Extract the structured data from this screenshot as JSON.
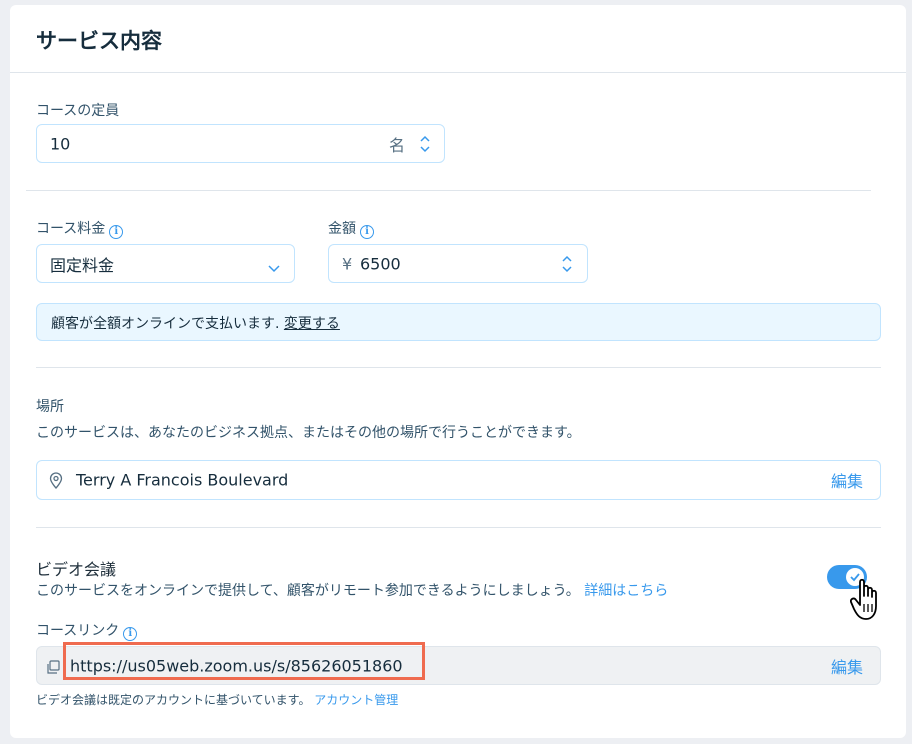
{
  "header": {
    "title": "サービス内容"
  },
  "capacity": {
    "label": "コースの定員",
    "value": "10",
    "unit": "名"
  },
  "pricing": {
    "fee_label": "コース料金",
    "fee_value": "固定料金",
    "amount_label": "金額",
    "currency_symbol": "¥",
    "amount_value": "6500",
    "notice_text": "顧客が全額オンラインで支払います.",
    "notice_link": "変更する"
  },
  "location": {
    "title": "場所",
    "description": "このサービスは、あなたのビジネス拠点、またはその他の場所で行うことができます。",
    "address": "Terry A Francois Boulevard",
    "edit_label": "編集"
  },
  "video": {
    "title": "ビデオ会議",
    "description": "このサービスをオンラインで提供して、顧客がリモート参加できるようにしましょう。",
    "details_link": "詳細はこちら",
    "toggle_on": true,
    "link_label": "コースリンク",
    "link_url": "https://us05web.zoom.us/s/85626051860",
    "link_edit_label": "編集",
    "footnote_text": "ビデオ会議は既定のアカウントに基づいています。",
    "footnote_link": "アカウント管理"
  },
  "colors": {
    "accent": "#3899ec",
    "highlight": "#ef6b4f",
    "notice_bg": "#eaf7ff"
  },
  "icons": [
    "info-icon",
    "chevron-down-icon",
    "stepper-icon",
    "location-pin-icon",
    "copy-icon",
    "check-icon",
    "hand-cursor-icon"
  ]
}
